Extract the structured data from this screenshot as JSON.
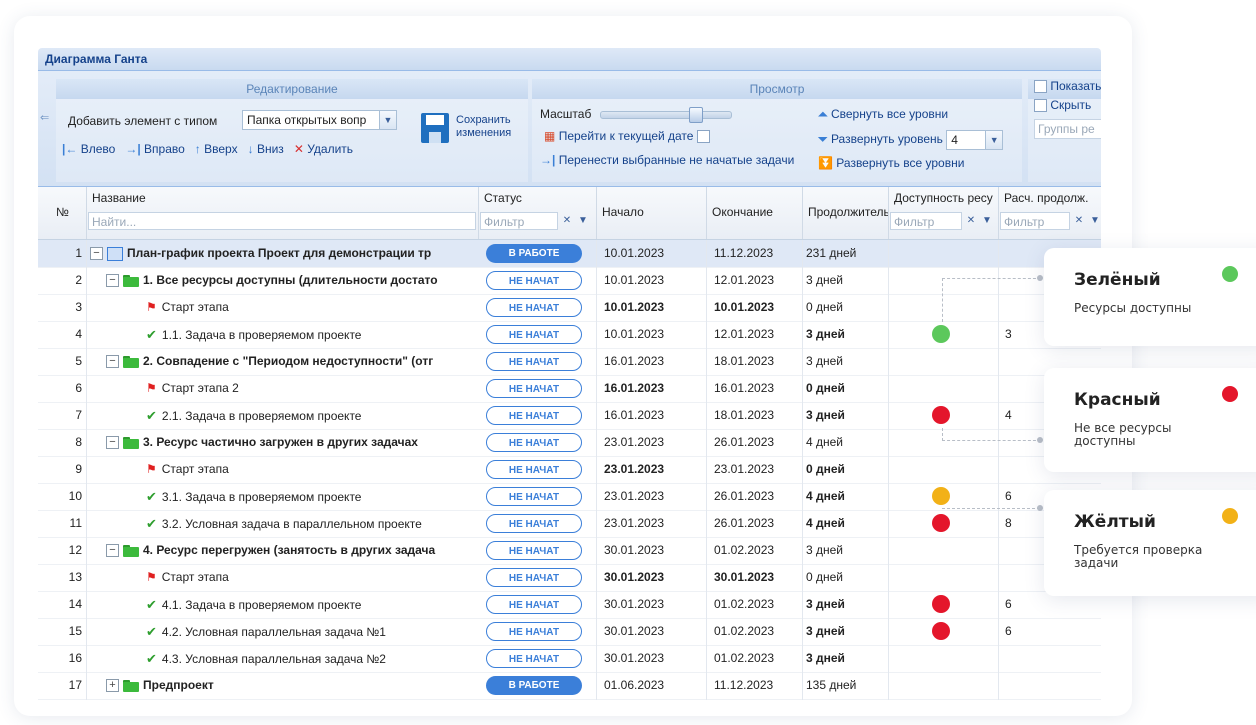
{
  "window": {
    "title": "Диаграмма Ганта"
  },
  "ribbon": {
    "edit_group": {
      "header": "Редактирование",
      "add_label": "Добавить элемент с типом",
      "add_type_value": "Папка открытых вопр",
      "save_label_1": "Сохранить",
      "save_label_2": "изменения",
      "left": "Влево",
      "right": "Вправо",
      "up": "Вверх",
      "down": "Вниз",
      "delete": "Удалить"
    },
    "view_group": {
      "header": "Просмотр",
      "scale_label": "Масштаб",
      "goto_today": "Перейти к текущей дате",
      "move_tasks": "Перенести выбранные не начатые задачи",
      "collapse_all": "Свернуть все уровни",
      "expand_level": "Развернуть уровень",
      "expand_level_value": "4",
      "expand_all": "Развернуть все уровни"
    },
    "more_group": {
      "show": "Показать",
      "hide": "Скрыть",
      "groups_placeholder": "Группы ре"
    }
  },
  "grid": {
    "columns": {
      "num": "№",
      "name": "Название",
      "name_filter": "Найти...",
      "status": "Статус",
      "status_filter": "Фильтр",
      "start": "Начало",
      "end": "Окончание",
      "duration": "Продолжительн",
      "availability": "Доступность ресу",
      "availability_filter": "Фильтр",
      "calc": "Расч. продолж.",
      "calc_filter": "Фильтр"
    },
    "rows": [
      {
        "num": "1",
        "name": "План-график проекта Проект для демонстрации тр",
        "status": "В РАБОТЕ",
        "start": "10.01.2023",
        "end": "11.12.2023",
        "duration": "231 дней",
        "calc": ""
      },
      {
        "num": "2",
        "name": "1. Все ресурсы доступны (длительности достато",
        "status": "НЕ НАЧАТ",
        "start": "10.01.2023",
        "end": "12.01.2023",
        "duration": "3 дней",
        "calc": ""
      },
      {
        "num": "3",
        "name": "Старт этапа",
        "status": "НЕ НАЧАТ",
        "start": "10.01.2023",
        "end": "10.01.2023",
        "duration": "0 дней",
        "calc": ""
      },
      {
        "num": "4",
        "name": "1.1. Задача в проверяемом проекте",
        "status": "НЕ НАЧАТ",
        "start": "10.01.2023",
        "end": "12.01.2023",
        "duration": "3 дней",
        "calc": "3"
      },
      {
        "num": "5",
        "name": "2. Совпадение с \"Периодом недоступности\" (отг",
        "status": "НЕ НАЧАТ",
        "start": "16.01.2023",
        "end": "18.01.2023",
        "duration": "3 дней",
        "calc": ""
      },
      {
        "num": "6",
        "name": "Старт этапа 2",
        "status": "НЕ НАЧАТ",
        "start": "16.01.2023",
        "end": "16.01.2023",
        "duration": "0 дней",
        "calc": ""
      },
      {
        "num": "7",
        "name": "2.1. Задача в проверяемом проекте",
        "status": "НЕ НАЧАТ",
        "start": "16.01.2023",
        "end": "18.01.2023",
        "duration": "3 дней",
        "calc": "4"
      },
      {
        "num": "8",
        "name": "3. Ресурс частично загружен в других задачах",
        "status": "НЕ НАЧАТ",
        "start": "23.01.2023",
        "end": "26.01.2023",
        "duration": "4 дней",
        "calc": ""
      },
      {
        "num": "9",
        "name": "Старт этапа",
        "status": "НЕ НАЧАТ",
        "start": "23.01.2023",
        "end": "23.01.2023",
        "duration": "0 дней",
        "calc": ""
      },
      {
        "num": "10",
        "name": "3.1. Задача в проверяемом проекте",
        "status": "НЕ НАЧАТ",
        "start": "23.01.2023",
        "end": "26.01.2023",
        "duration": "4 дней",
        "calc": "6"
      },
      {
        "num": "11",
        "name": "3.2. Условная задача в параллельном проекте",
        "status": "НЕ НАЧАТ",
        "start": "23.01.2023",
        "end": "26.01.2023",
        "duration": "4 дней",
        "calc": "8"
      },
      {
        "num": "12",
        "name": "4. Ресурс перегружен (занятость в других задача",
        "status": "НЕ НАЧАТ",
        "start": "30.01.2023",
        "end": "01.02.2023",
        "duration": "3 дней",
        "calc": ""
      },
      {
        "num": "13",
        "name": "Старт этапа",
        "status": "НЕ НАЧАТ",
        "start": "30.01.2023",
        "end": "30.01.2023",
        "duration": "0 дней",
        "calc": ""
      },
      {
        "num": "14",
        "name": "4.1. Задача в проверяемом проекте",
        "status": "НЕ НАЧАТ",
        "start": "30.01.2023",
        "end": "01.02.2023",
        "duration": "3 дней",
        "calc": "6"
      },
      {
        "num": "15",
        "name": "4.2. Условная параллельная задача №1",
        "status": "НЕ НАЧАТ",
        "start": "30.01.2023",
        "end": "01.02.2023",
        "duration": "3 дней",
        "calc": "6"
      },
      {
        "num": "16",
        "name": "4.3. Условная параллельная задача №2",
        "status": "НЕ НАЧАТ",
        "start": "30.01.2023",
        "end": "01.02.2023",
        "duration": "3 дней",
        "calc": ""
      },
      {
        "num": "17",
        "name": "Предпроект",
        "status": "В РАБОТЕ",
        "start": "01.06.2023",
        "end": "11.12.2023",
        "duration": "135 дней",
        "calc": ""
      }
    ]
  },
  "legend": [
    {
      "title": "Зелёный",
      "desc": "Ресурсы доступны",
      "color": "#5cc85c"
    },
    {
      "title": "Красный",
      "desc": "Не все ресурсы доступны",
      "color": "#e4162b"
    },
    {
      "title": "Жёлтый",
      "desc": "Требуется проверка задачи",
      "color": "#f2b117"
    }
  ],
  "colors": {
    "accent": "#3b7fd9",
    "availability_green": "#5cc85c",
    "availability_red": "#e4162b",
    "availability_yellow": "#f2b117"
  }
}
